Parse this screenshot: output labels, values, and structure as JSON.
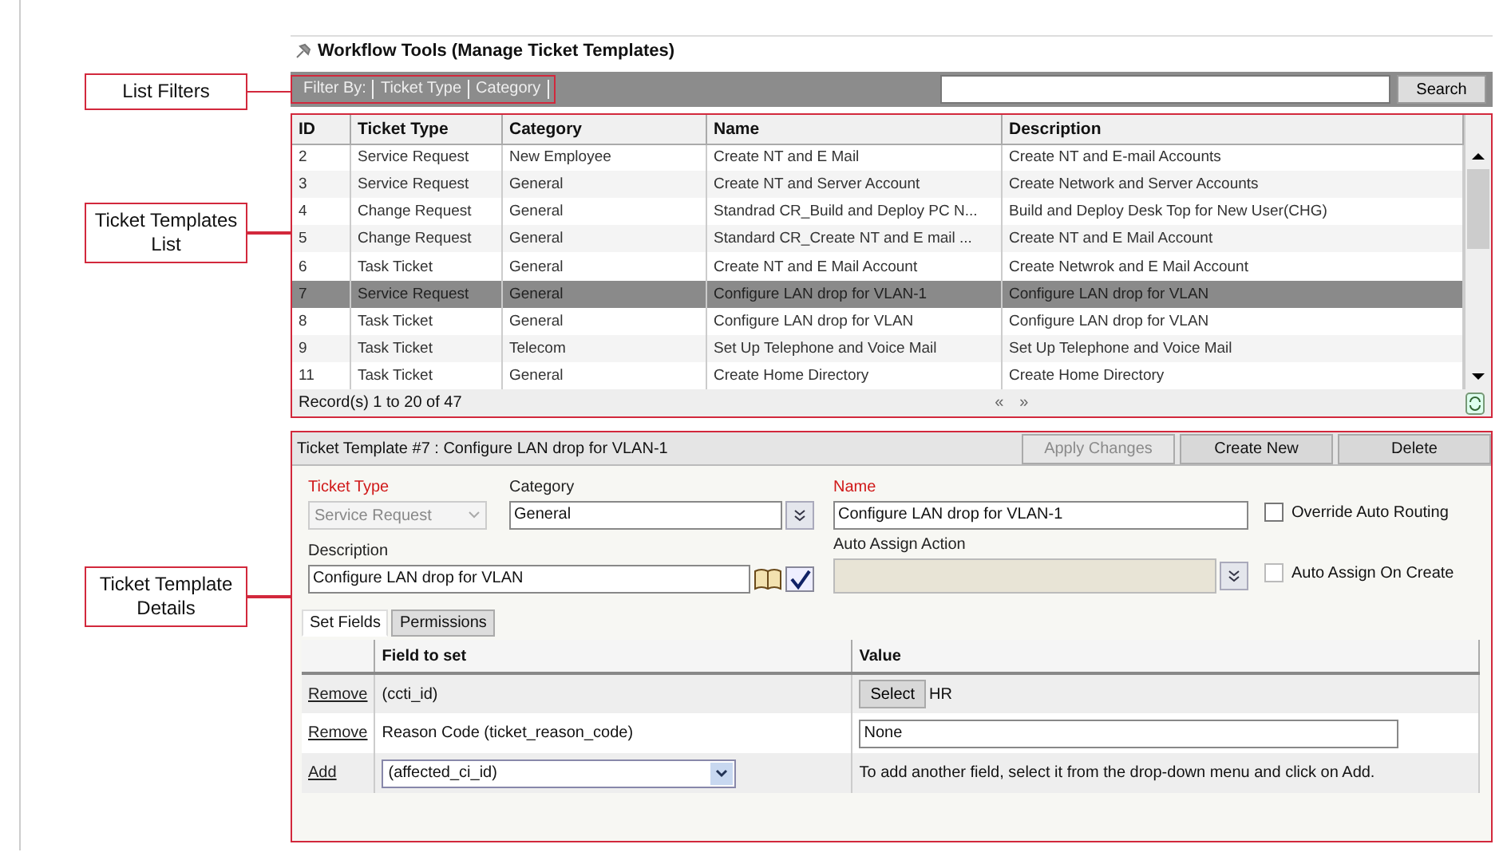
{
  "callouts": [
    {
      "text": "List Filters"
    },
    {
      "text": "Ticket Templates List"
    },
    {
      "text": "Ticket Template Details"
    }
  ],
  "window": {
    "title": "Workflow Tools (Manage Ticket Templates)"
  },
  "filter_bar": {
    "label": "Filter By:",
    "filters": [
      "Ticket Type",
      "Category"
    ],
    "search_button": "Search"
  },
  "templates_table": {
    "columns": [
      "ID",
      "Ticket Type",
      "Category",
      "Name",
      "Description"
    ],
    "rows": [
      {
        "cells": [
          "2",
          "Service Request",
          "New Employee",
          "Create NT and E Mail",
          "Create NT and E-mail Accounts"
        ],
        "selected": false
      },
      {
        "cells": [
          "3",
          "Service Request",
          "General",
          "Create NT and Server Account",
          "Create Network and Server Accounts"
        ],
        "selected": false
      },
      {
        "cells": [
          "4",
          "Change Request",
          "General",
          "Standrad CR_Build and Deploy PC N...",
          "Build and Deploy Desk Top for New User(CHG)"
        ],
        "selected": false
      },
      {
        "cells": [
          "5",
          "Change Request",
          "General",
          "Standard CR_Create NT and E mail ...",
          "Create NT and E Mail Account"
        ],
        "selected": false
      },
      {
        "cells": [
          "6",
          "Task Ticket",
          "General",
          "Create NT and E Mail Account",
          "Create Netwrok and E Mail Account"
        ],
        "selected": false
      },
      {
        "cells": [
          "7",
          "Service Request",
          "General",
          "Configure LAN drop for VLAN-1",
          "Configure LAN drop for VLAN"
        ],
        "selected": true
      },
      {
        "cells": [
          "8",
          "Task Ticket",
          "General",
          "Configure LAN drop for VLAN",
          "Configure LAN drop for VLAN"
        ],
        "selected": false
      },
      {
        "cells": [
          "9",
          "Task Ticket",
          "Telecom",
          "Set Up Telephone and Voice Mail",
          "Set Up Telephone and Voice Mail"
        ],
        "selected": false
      },
      {
        "cells": [
          "11",
          "Task Ticket",
          "General",
          "Create Home Directory",
          "Create Home Directory"
        ],
        "selected": false
      }
    ],
    "records": "Record(s) 1 to 20 of 47",
    "pager": [
      "«",
      "»"
    ]
  },
  "details": {
    "title": "Ticket Template #7 : Configure LAN drop for VLAN-1",
    "buttons": [
      {
        "label": "Apply Changes",
        "disabled": true
      },
      {
        "label": "Create New",
        "disabled": false
      },
      {
        "label": "Delete",
        "disabled": false
      }
    ],
    "ticket_type": {
      "label": "Ticket Type",
      "value": "Service Request",
      "required": true,
      "disabled": true
    },
    "category": {
      "label": "Category",
      "value": "General",
      "required": false,
      "disabled": false
    },
    "name": {
      "label": "Name",
      "value": "Configure LAN drop for VLAN-1",
      "required": true
    },
    "description": {
      "label": "Description",
      "value": "Configure LAN drop for VLAN",
      "required": false
    },
    "auto_assign_action": {
      "label": "Auto Assign Action",
      "required": false,
      "disabled": true
    },
    "checkboxes": [
      {
        "label": "Override Auto Routing",
        "checked": false,
        "disabled": false
      },
      {
        "label": "Auto Assign On Create",
        "checked": false,
        "disabled": true
      }
    ],
    "tabs": [
      {
        "label": "Set Fields",
        "selected": true
      },
      {
        "label": "Permissions",
        "selected": false
      }
    ],
    "set_fields": {
      "columns": [
        "Field to set",
        "Value"
      ],
      "rows": [
        {
          "kind": "select",
          "action": "Remove",
          "field": "(ccti_id)",
          "button": "Select",
          "value": "HR"
        },
        {
          "kind": "input",
          "action": "Remove",
          "field": "Reason Code (ticket_reason_code)",
          "value": "None"
        },
        {
          "kind": "add",
          "action": "Add",
          "field": "(affected_ci_id)",
          "value": "To add another field, select it from the drop-down menu and click on Add."
        }
      ]
    }
  }
}
